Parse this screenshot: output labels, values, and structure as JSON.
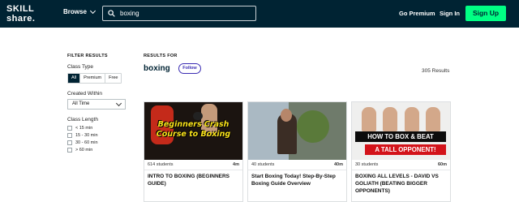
{
  "brand": {
    "line1": "SKILL",
    "line2": "share.",
    "accent": "#00ff84",
    "nav_bg": "#002333"
  },
  "topnav": {
    "browse_label": "Browse",
    "search_value": "boxing",
    "go_premium": "Go Premium",
    "sign_in": "Sign In",
    "sign_up": "Sign Up"
  },
  "filters": {
    "heading": "FILTER RESULTS",
    "class_type_label": "Class Type",
    "class_type_options": [
      "All",
      "Premium",
      "Free"
    ],
    "class_type_selected": "All",
    "created_within_label": "Created Within",
    "created_within_value": "All Time",
    "class_length_label": "Class Length",
    "class_length_options": [
      "< 15 min",
      "15 - 30 min",
      "30 - 60 min",
      "> 60 min"
    ]
  },
  "results": {
    "heading": "RESULTS FOR",
    "query": "boxing",
    "follow_label": "Follow",
    "count_text": "305 Results"
  },
  "cards": [
    {
      "students": "614 students",
      "duration": "4m",
      "title": "INTRO TO BOXING (BEGINNERS GUIDE)",
      "thumb_text_1": "Beginners Crash",
      "thumb_text_2": "Course to Boxing"
    },
    {
      "students": "40 students",
      "duration": "40m",
      "title": "Start Boxing Today! Step-By-Step Boxing Guide Overview"
    },
    {
      "students": "30 students",
      "duration": "60m",
      "title": "BOXING ALL LEVELS - DAVID VS GOLIATH (BEATING BIGGER OPPONENTS)",
      "thumb_text_1": "HOW TO BOX & BEAT",
      "thumb_text_2": "A TALL OPPONENT!"
    }
  ]
}
